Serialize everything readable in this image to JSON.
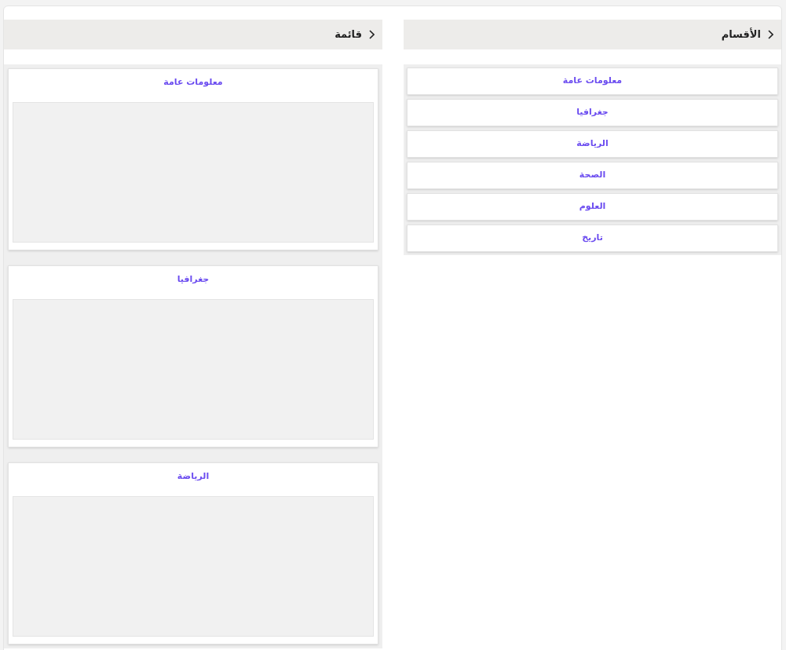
{
  "sections_panel": {
    "title": "الأقسام",
    "items": [
      {
        "label": "معلومات عامة"
      },
      {
        "label": "جغرافيا"
      },
      {
        "label": "الرياضة"
      },
      {
        "label": "الصحة"
      },
      {
        "label": "العلوم"
      },
      {
        "label": "تاريخ"
      }
    ]
  },
  "list_panel": {
    "title": "قائمة",
    "cards": [
      {
        "title": "معلومات عامة"
      },
      {
        "title": "جغرافيا"
      },
      {
        "title": "الرياضة"
      }
    ]
  }
}
